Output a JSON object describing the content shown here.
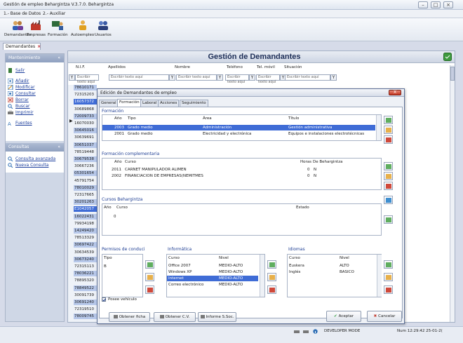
{
  "window": {
    "title": "Gestión de empleo Behargintza V.3.7.0.   Behargintza",
    "min": "–",
    "max": "□",
    "close": "×"
  },
  "menu": {
    "item1": "1.- Base de Datos",
    "item2": "2.- Auxiliar"
  },
  "toolbar": {
    "demandantes": "Demandantes",
    "empresas": "Empresas",
    "formacion": "Formación",
    "autoempleo": "Autoempleo",
    "usuarios": "Usuarios"
  },
  "doc_tab": {
    "label": "Demandantes",
    "close": "×"
  },
  "sidebar": {
    "mant_title": "Mantenimiento",
    "mant_items": [
      "Salir",
      "Añadir",
      "Modificar",
      "Consultar",
      "Borrar",
      "Buscar",
      "Imprimir",
      "Fuentes"
    ],
    "cons_title": "Consultas",
    "cons_items": [
      "Consulta avanzada",
      "Nueva Consulta"
    ],
    "chev": "«"
  },
  "main": {
    "title": "Gestión de Demandantes",
    "cols": {
      "nif": "N.I.F.",
      "apellidos": "Apellidos",
      "nombre": "Nombre",
      "telefono": "Teléfono",
      "movil": "Tel. móvil",
      "situacion": "Situación"
    },
    "filter_placeholder": "Escribir texto aquí",
    "row_ids": [
      "78610171",
      "72315203",
      "16057372",
      "30689868",
      "72009733",
      "16070030",
      "30645016",
      "30639691",
      "30651037",
      "78519448",
      "30679538",
      "30667236",
      "05301654",
      "45791754",
      "78010029",
      "72317665",
      "30201263",
      "E1042057",
      "16022431",
      "79934198",
      "14249420",
      "78513329",
      "30697422",
      "30634539",
      "30673240",
      "72315113",
      "78036221",
      "78895320",
      "78849522",
      "30091739",
      "30691240",
      "72319510",
      "78009745"
    ]
  },
  "dialog": {
    "title": "Edición de Demandantes de empleo",
    "close": "X",
    "tabs": [
      "General",
      "Formación",
      "Laboral",
      "Acciones",
      "Seguimiento"
    ],
    "formacion": {
      "title": "Formación",
      "headers": {
        "anio": "Año",
        "tipo": "Tipo",
        "area": "Área",
        "titulo": "Título"
      },
      "rows": [
        {
          "anio": "2003",
          "tipo": "Grado medio",
          "area": "Administración",
          "titulo": "Gestión administrativa"
        },
        {
          "anio": "2001",
          "tipo": "Grado medio",
          "area": "Electricidad y electrónica",
          "titulo": "Equipos e instalaciones electrotécnicas"
        }
      ]
    },
    "complementaria": {
      "title": "Formación complementaria",
      "headers": {
        "anio": "Año",
        "curso": "Curso",
        "horas": "Horas",
        "behargintza": "De Behargintza"
      },
      "rows": [
        {
          "anio": "2011",
          "curso": "CARNET MANIPULADOR ALIMEN",
          "horas": "0",
          "beh": "N"
        },
        {
          "anio": "2002",
          "curso": "FINANCIACION DE EMPRESAS(NEMITMES",
          "horas": "0",
          "beh": "N"
        }
      ]
    },
    "cursos": {
      "title": "Cursos Behargintza",
      "headers": {
        "anio": "Año",
        "curso": "Curso",
        "estado": "Estado"
      },
      "row_value": "0"
    },
    "permisos": {
      "title": "Permisos de conduci",
      "header": "Tipo",
      "rows": [
        "B"
      ]
    },
    "informatica": {
      "title": "Informática",
      "headers": {
        "curso": "Curso",
        "nivel": "Nivel"
      },
      "rows": [
        {
          "curso": "Office 2007",
          "nivel": "MEDIO-ALTO"
        },
        {
          "curso": "Windows XP",
          "nivel": "MEDIO-ALTO"
        },
        {
          "curso": "Internet",
          "nivel": "MEDIO-ALTO"
        },
        {
          "curso": "Correo electrónico",
          "nivel": "MEDIO-ALTO"
        }
      ]
    },
    "idiomas": {
      "title": "Idiomas",
      "headers": {
        "curso": "Curso",
        "nivel": "Nivel"
      },
      "rows": [
        {
          "curso": "Euskera",
          "nivel": "ALTO"
        },
        {
          "curso": "Inglés",
          "nivel": "BASICO"
        }
      ]
    },
    "vehiculo": "Posee vehículo",
    "buttons": {
      "ficha": "Obtener ficha",
      "cv": "Obtener C.V.",
      "informe": "Informe S.Soc.",
      "aceptar": "Aceptar",
      "cancelar": "Cancelar"
    }
  },
  "status": {
    "mode": "DEVELOPER MODE",
    "info": "Num  12:29:42  25-01-2("
  },
  "colors": {
    "accent": "#3f6cd6",
    "title_text": "#1d2e57",
    "link": "#1c3e9c",
    "close_red": "#c2331d",
    "accept_green": "#2f9a3a"
  }
}
